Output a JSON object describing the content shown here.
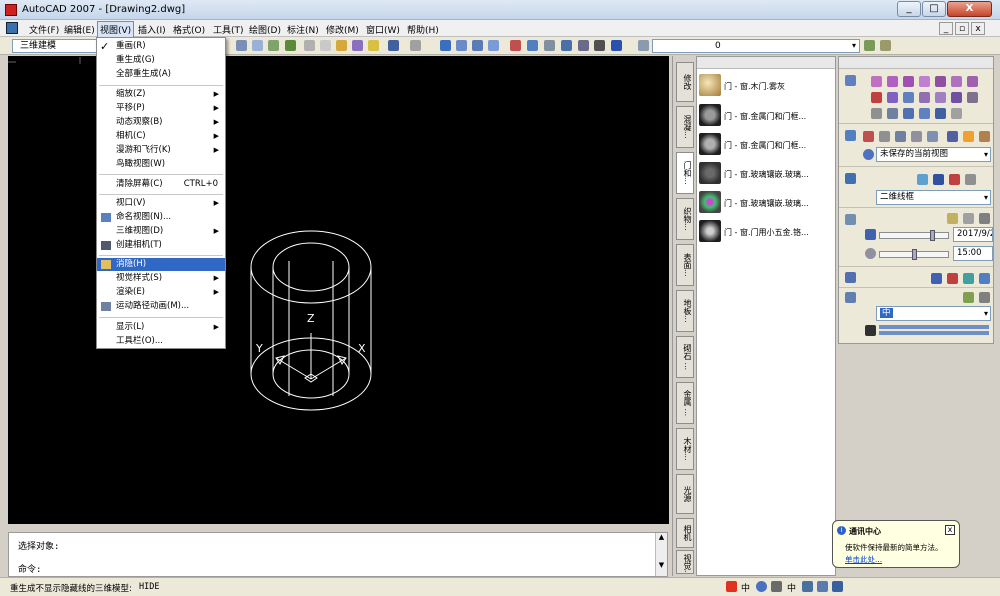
{
  "window": {
    "title": "AutoCAD 2007 - [Drawing2.dwg]",
    "minimize": "_",
    "maximize": "□",
    "close": "X"
  },
  "menubar": {
    "items": [
      "文件(F)",
      "编辑(E)",
      "视图(V)",
      "插入(I)",
      "格式(O)",
      "工具(T)",
      "绘图(D)",
      "标注(N)",
      "修改(M)",
      "窗口(W)",
      "帮助(H)"
    ],
    "active_index": 2,
    "mdi_min": "_",
    "mdi_restore": "▫",
    "mdi_close": "x"
  },
  "toolbar": {
    "workspace": "三维建模",
    "layer": "0",
    "layer_arrow": "▾"
  },
  "view_menu": {
    "items": {
      "redraw": "重画(R)",
      "regen": "重生成(G)",
      "regen_all": "全部重生成(A)",
      "zoom": "缩放(Z)",
      "pan": "平移(P)",
      "orbit": "动态观察(B)",
      "camera": "相机(C)",
      "walk_fly": "漫游和飞行(K)",
      "aerial": "鸟瞰视图(W)",
      "clean_screen": "清除屏幕(C)",
      "clean_screen_shortcut": "CTRL+0",
      "viewports": "视口(V)",
      "named_views": "命名视图(N)...",
      "views_3d": "三维视图(D)",
      "create_camera": "创建相机(T)",
      "hide": "消隐(H)",
      "visual_styles": "视觉样式(S)",
      "render": "渲染(E)",
      "motion_path": "运动路径动画(M)...",
      "display": "显示(L)",
      "toolbars": "工具栏(O)..."
    },
    "submenu_arrow": "▶",
    "checkmark": "✓"
  },
  "drawing": {
    "labels": {
      "z": "Z",
      "x": "X",
      "y": "Y"
    }
  },
  "command": {
    "line1": "选择对象:",
    "line2": "命令:",
    "up": "▲",
    "down": "▼"
  },
  "status": {
    "message": "重生成不显示隐藏线的三维模型:",
    "command": "HIDE"
  },
  "palette_tabs": [
    "修改",
    "混凝...",
    "门和...",
    "织物...",
    "表面...",
    "地板...",
    "砌石 ...",
    "金属 ...",
    "木材...",
    "光源",
    "相机",
    "视觉..."
  ],
  "palette_tabs_active": 2,
  "materials": [
    {
      "name": "门 - 窗.木门.雾灰",
      "color": "#c9a86b"
    },
    {
      "name": "门 - 窗.金属门和门框...",
      "color": "#1e1e1e"
    },
    {
      "name": "门 - 窗.金属门和门框...",
      "color": "#1e1e1e"
    },
    {
      "name": "门 - 窗.玻璃镶嵌.玻璃...",
      "color": "#303030"
    },
    {
      "name": "门 - 窗.玻璃镶嵌.玻璃...",
      "color": "#444444"
    },
    {
      "name": "门 - 窗.门用小五金.铬...",
      "color": "#1e1e1e"
    }
  ],
  "dashboard": {
    "view_combo": "未保存的当前视图",
    "visual_style_combo": "二维线框",
    "date": "2017/9/2",
    "time": "15:00",
    "material_combo": "中",
    "arrow": "▾"
  },
  "balloon": {
    "title": "通讯中心",
    "text": "使软件保持最新的简单方法。",
    "link": "单击此处...",
    "close": "x",
    "info": "i"
  },
  "tray": {
    "ime1": "中",
    "ime2": "中"
  }
}
